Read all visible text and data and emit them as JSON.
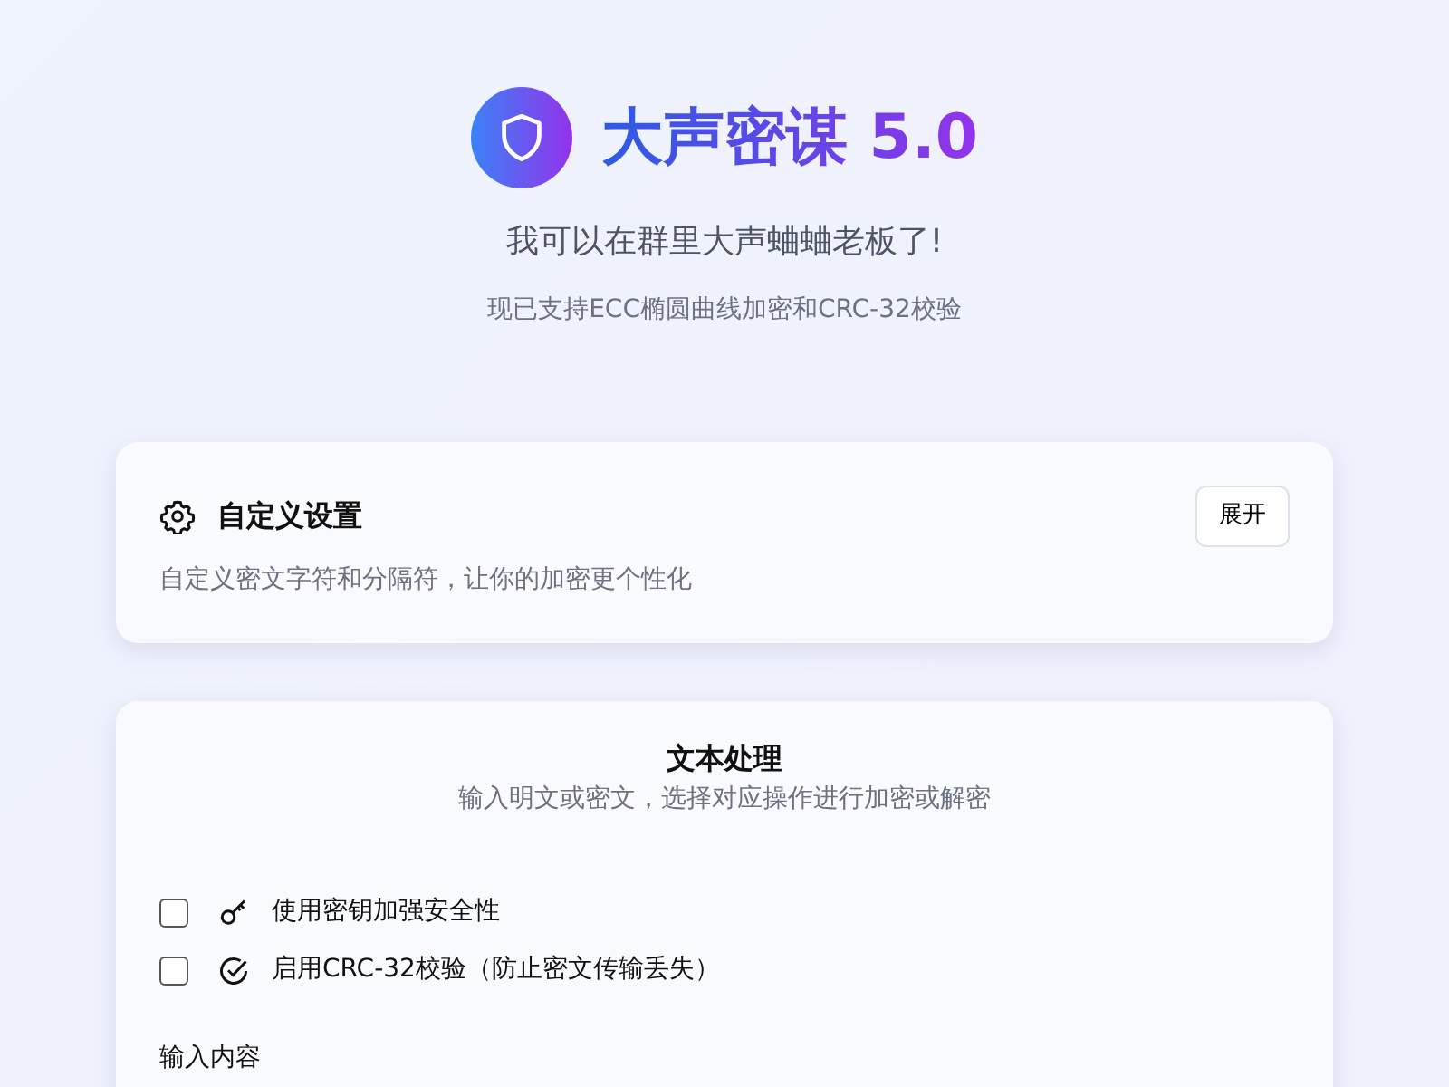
{
  "header": {
    "title": "大声密谋 5.0",
    "tagline": "我可以在群里大声蛐蛐老板了!",
    "note": "现已支持ECC椭圆曲线加密和CRC-32校验"
  },
  "settings_card": {
    "title": "自定义设置",
    "description": "自定义密文字符和分隔符，让你的加密更个性化",
    "button": "展开"
  },
  "text_card": {
    "title": "文本处理",
    "subtitle": "输入明文或密文，选择对应操作进行加密或解密",
    "options": [
      {
        "kind": "key",
        "label": "使用密钥加强安全性",
        "checked": false
      },
      {
        "kind": "verify",
        "label": "启用CRC-32校验（防止密文传输丢失）",
        "checked": false
      }
    ],
    "input_label": "输入内容"
  }
}
